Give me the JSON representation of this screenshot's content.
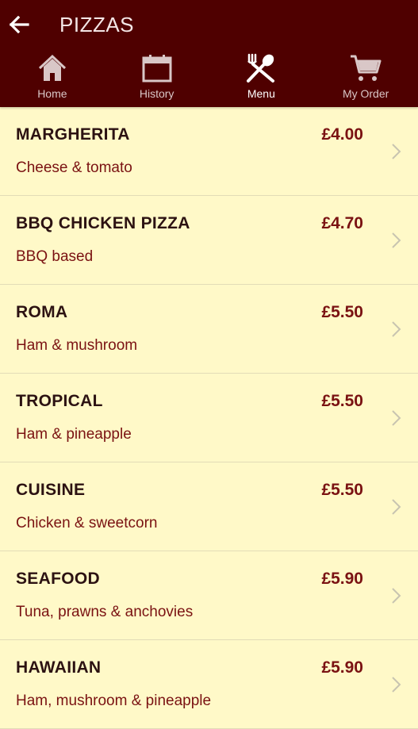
{
  "header": {
    "title": "PIZZAS",
    "back_icon": "arrow-left-icon"
  },
  "nav": {
    "items": [
      {
        "label": "Home",
        "icon": "home-icon",
        "active": false
      },
      {
        "label": "History",
        "icon": "calendar-icon",
        "active": false
      },
      {
        "label": "Menu",
        "icon": "fork-spoon-icon",
        "active": true
      },
      {
        "label": "My Order",
        "icon": "cart-icon",
        "active": false
      }
    ]
  },
  "menu": {
    "items": [
      {
        "name": "MARGHERITA",
        "desc": "Cheese & tomato",
        "price": "£4.00"
      },
      {
        "name": "BBQ CHICKEN PIZZA",
        "desc": "BBQ based",
        "price": "£4.70"
      },
      {
        "name": "ROMA",
        "desc": "Ham & mushroom",
        "price": "£5.50"
      },
      {
        "name": "TROPICAL",
        "desc": "Ham & pineapple",
        "price": "£5.50"
      },
      {
        "name": "CUISINE",
        "desc": "Chicken & sweetcorn",
        "price": "£5.50"
      },
      {
        "name": "SEAFOOD",
        "desc": "Tuna, prawns & anchovies",
        "price": "£5.90"
      },
      {
        "name": "HAWAIIAN",
        "desc": "Ham, mushroom & pineapple",
        "price": "£5.90"
      }
    ]
  },
  "colors": {
    "header_bg": "#4f0000",
    "list_bg": "#fff9c8",
    "accent": "#7a1212"
  }
}
